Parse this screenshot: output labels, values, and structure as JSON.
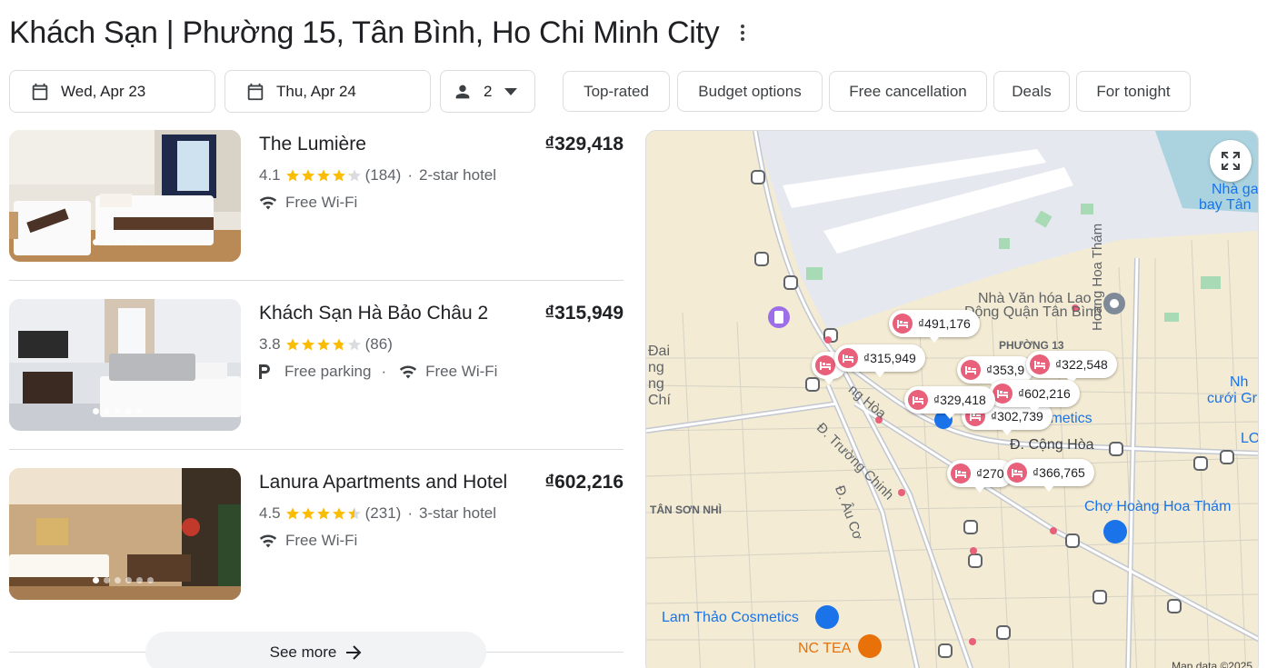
{
  "header": {
    "title": "Khách Sạn | Phường 15, Tân Bình, Ho Chi Minh City"
  },
  "search": {
    "check_in": "Wed, Apr 23",
    "check_out": "Thu, Apr 24",
    "guests": "2"
  },
  "filters": [
    "Top-rated",
    "Budget options",
    "Free cancellation",
    "Deals",
    "For tonight"
  ],
  "hotels": [
    {
      "name": "The Lumière",
      "price": "₫329,418",
      "rating": "4.1",
      "stars": 4.1,
      "reviews": "(184)",
      "class": "2-star hotel",
      "amenities": [
        "Free Wi-Fi"
      ]
    },
    {
      "name": "Khách Sạn Hà Bảo Châu 2",
      "price": "₫315,949",
      "rating": "3.8",
      "stars": 3.8,
      "reviews": "(86)",
      "class": "",
      "amenities": [
        "Free parking",
        "Free Wi-Fi"
      ]
    },
    {
      "name": "Lanura Apartments and Hotel",
      "price": "₫602,216",
      "rating": "4.5",
      "stars": 4.5,
      "reviews": "(231)",
      "class": "3-star hotel",
      "amenities": [
        "Free Wi-Fi"
      ]
    }
  ],
  "see_more": "See more",
  "map": {
    "pins": [
      "₫491,176",
      "₫315,949",
      "₫353,9",
      "₫322,548",
      "₫602,216",
      "₫329,418",
      "₫302,739",
      "₫270",
      "₫366,765"
    ],
    "labels": {
      "nha_ga": "Nhà ga",
      "bay_tan": "bay Tân",
      "nha_van_hoa": "Nhà Văn hóa Lao",
      "dong_quan": "Động Quận Tân Bình",
      "phuong13": "PHƯỜNG 13",
      "hoang_hoa_tham_road": "Hoàng Hoa Thám",
      "nh": "Nh",
      "cuoi_gr": "cưới Gr",
      "lo": "LO",
      "dai": "Đai",
      "ng1": "ng",
      "ng2": "ng",
      "chi": "Chí",
      "ng_hoa": "ng Hòa",
      "cosmetics": "Cosmetics",
      "cong_hoa": "Đ. Cộng Hòa",
      "truong_chinh": "Đ. Trường Chinh",
      "au_co": "Đ. Âu Cơ",
      "tan_son_nhi": "TÂN SƠN NHÌ",
      "cho_hht": "Chợ Hoàng Hoa Thám",
      "lam_thao": "Lam Thảo Cosmetics",
      "nc_tea": "NC TEA"
    },
    "attribution": "Map data ©2025"
  }
}
